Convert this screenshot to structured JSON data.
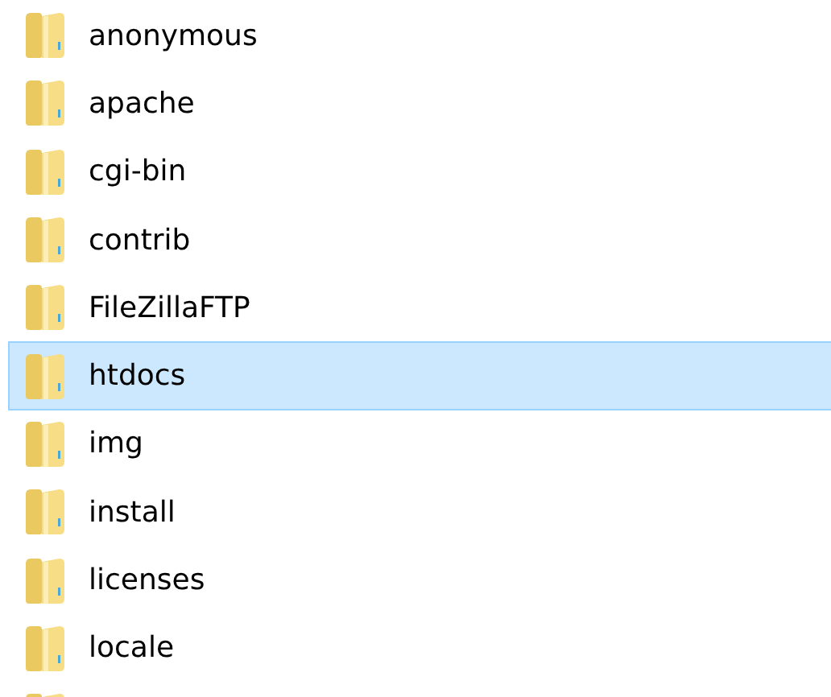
{
  "files": [
    {
      "name": "anonymous",
      "selected": false
    },
    {
      "name": "apache",
      "selected": false
    },
    {
      "name": "cgi-bin",
      "selected": false
    },
    {
      "name": "contrib",
      "selected": false
    },
    {
      "name": "FileZillaFTP",
      "selected": false
    },
    {
      "name": "htdocs",
      "selected": true
    },
    {
      "name": "img",
      "selected": false
    },
    {
      "name": "install",
      "selected": false
    },
    {
      "name": "licenses",
      "selected": false
    },
    {
      "name": "locale",
      "selected": false
    }
  ]
}
